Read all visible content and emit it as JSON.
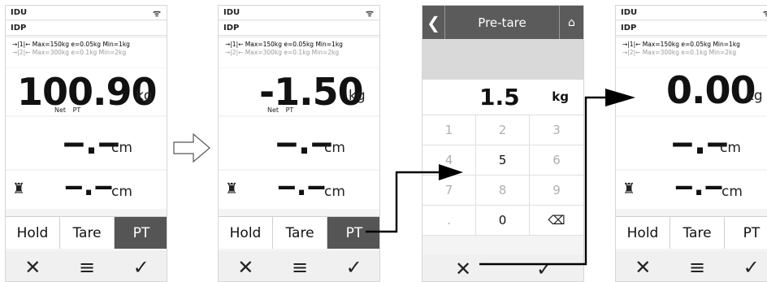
{
  "screens": [
    {
      "header1": "IDU",
      "header2": "IDP",
      "range1": "→|1|← Max=150kg e=0.05kg Min=1kg",
      "range2": "→|2|← Max=300kg e=0.1kg Min=2kg",
      "weight": "100.90",
      "unit": "kg",
      "net_label": "Net  PT",
      "cm_value": "‒.‒",
      "cm_unit": "cm",
      "len_value": "‒.‒",
      "len_unit": "cm",
      "buttons": [
        "Hold",
        "Tare",
        "PT"
      ]
    },
    {
      "header1": "IDU",
      "header2": "IDP",
      "range1": "→|1|← Max=150kg e=0.05kg Min=1kg",
      "range2": "→|2|← Max=300kg e=0.1kg Min=2kg",
      "weight": "-1.50",
      "unit": "kg",
      "net_label": "Net  PT",
      "cm_value": "‒.‒",
      "cm_unit": "cm",
      "len_value": "‒.‒",
      "len_unit": "cm",
      "buttons": [
        "Hold",
        "Tare",
        "PT"
      ]
    },
    {
      "title": "Pre-tare",
      "entry_value": "1.5",
      "entry_unit": "kg",
      "keys": [
        "1",
        "2",
        "3",
        "4",
        "5",
        "6",
        "7",
        "8",
        "9",
        ".",
        "0",
        "⌫"
      ]
    },
    {
      "header1": "IDU",
      "header2": "IDP",
      "range1": "→|1|← Max=150kg e=0.05kg Min=1kg",
      "range2": "→|2|← Max=300kg e=0.1kg Min=2kg",
      "weight": "0.00",
      "unit": "kg",
      "cm_value": "‒.‒",
      "cm_unit": "cm",
      "len_value": "‒.‒",
      "len_unit": "cm",
      "buttons": [
        "Hold",
        "Tare",
        "PT"
      ]
    }
  ],
  "nav": {
    "cancel": "✕",
    "menu": "≡",
    "ok": "✓"
  },
  "icons": {
    "wifi": "wifi-icon",
    "person": "person-icon",
    "back": "back-chevron-icon",
    "home": "home-icon"
  }
}
